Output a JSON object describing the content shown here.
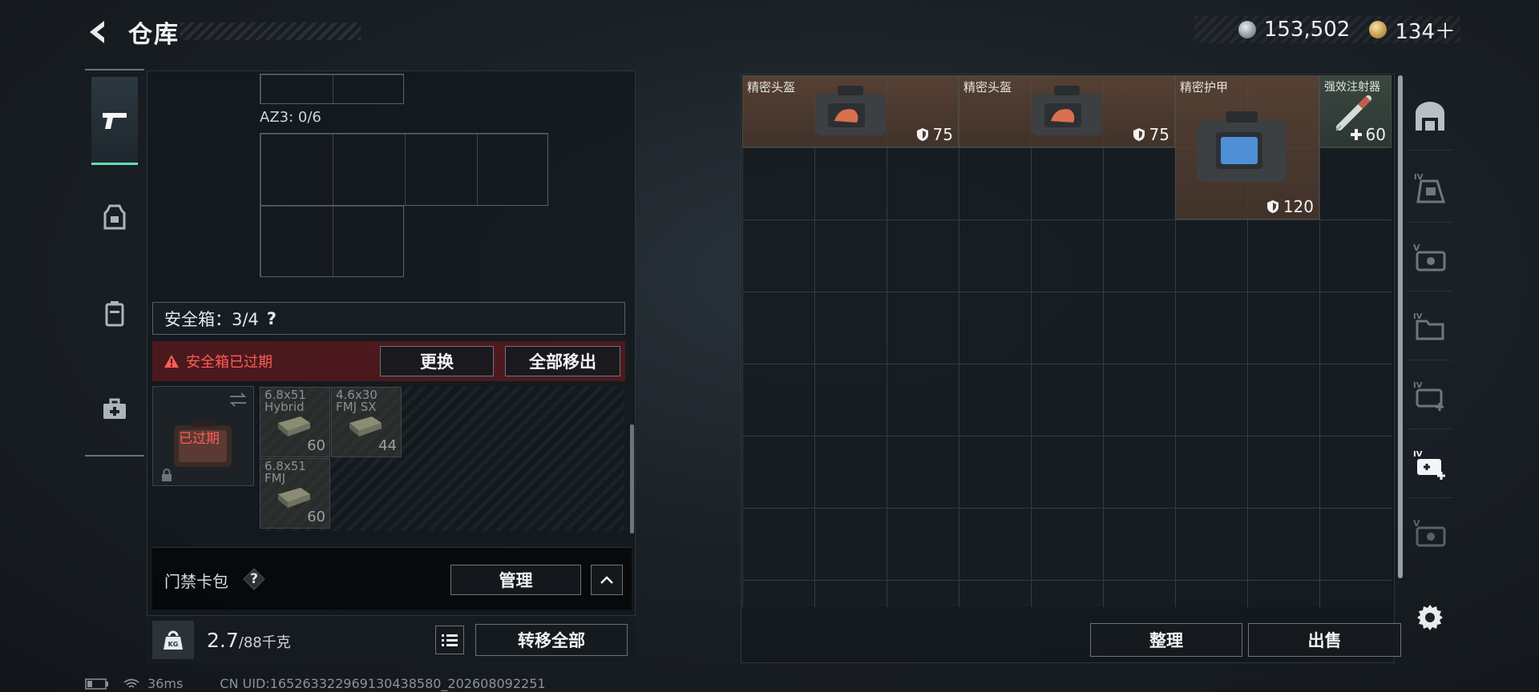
{
  "header": {
    "title": "仓库",
    "currency_silver": "153,502",
    "currency_gold": "134＋"
  },
  "left_panel": {
    "az3_label": "AZ3: 0/6",
    "safe_box": {
      "label": "安全箱：3/4",
      "help": "?",
      "expired_warning": "安全箱已过期",
      "replace_button": "更换",
      "remove_all_button": "全部移出",
      "expired_stamp": "已过期"
    },
    "ammo": [
      {
        "name": "6.8x51 Hybrid",
        "count": "60"
      },
      {
        "name": "4.6x30 FMJ SX",
        "count": "44"
      },
      {
        "name": "6.8x51 FMJ",
        "count": "60"
      }
    ],
    "card_wallet": {
      "label": "门禁卡包",
      "help": "?",
      "manage_button": "管理"
    },
    "weight": {
      "value": "2.7",
      "unit": "/88千克",
      "transfer_all_button": "转移全部"
    }
  },
  "stash": {
    "items": [
      {
        "name": "精密头盔",
        "value": "75",
        "stat": "armor"
      },
      {
        "name": "精密头盔",
        "value": "75",
        "stat": "armor"
      },
      {
        "name": "精密护甲",
        "value": "120",
        "stat": "armor"
      },
      {
        "name": "强效注射器",
        "value": "60",
        "stat": "heal"
      }
    ],
    "sort_button": "整理",
    "sell_button": "出售"
  },
  "status": {
    "ping": "36ms",
    "uid": "CN UID:1652633229691304385​80_202608092251"
  },
  "colors": {
    "accent_green": "#5ee0b4",
    "warning_red": "#ff5c55",
    "item_brown": "#604636"
  }
}
